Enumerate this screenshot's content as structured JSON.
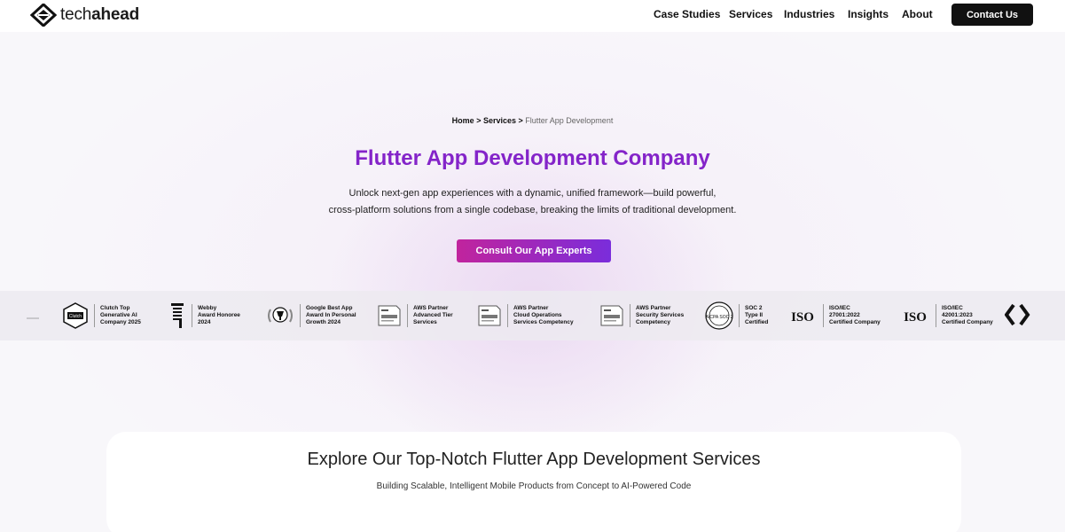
{
  "header": {
    "logo_text_light": "tech",
    "logo_text_bold": "ahead",
    "nav": [
      {
        "label": "Case Studies"
      },
      {
        "label": "Services"
      },
      {
        "label": "Industries"
      },
      {
        "label": "Insights"
      },
      {
        "label": "About"
      }
    ],
    "contact_label": "Contact Us"
  },
  "hero": {
    "breadcrumb": {
      "home": "Home",
      "sep1": " > ",
      "services": "Services",
      "sep2": " > ",
      "current": "Flutter App Development"
    },
    "title": "Flutter App Development Company",
    "subtitle_line1": "Unlock next-gen app experiences with a dynamic, unified framework—build powerful,",
    "subtitle_line2": "cross-platform solutions from a single codebase, breaking the limits of traditional development.",
    "cta_label": "Consult Our App Experts"
  },
  "awards": [
    {
      "icon": "clutch-badge-icon",
      "icon_label": "Clutch",
      "text": "Clutch Top\nGenerative AI\nCompany 2025"
    },
    {
      "icon": "webby-award-icon",
      "text": "Webby\nAward Honoree\n2024"
    },
    {
      "icon": "google-best-app-icon",
      "text": "Google Best App\nAward In Personal\nGrowth 2024"
    },
    {
      "icon": "aws-partner-icon",
      "text": "AWS Partner\nAdvanced Tier\nServices"
    },
    {
      "icon": "aws-partner-icon",
      "text": "AWS Partner\nCloud Operations\nServices Competency"
    },
    {
      "icon": "aws-partner-icon",
      "text": "AWS Partner\nSecurity Services\nCompetency"
    },
    {
      "icon": "aicpa-soc2-icon",
      "icon_label": "AICPA SOC 2",
      "text": "SOC 2\nType II\nCertified"
    },
    {
      "icon": "iso-logo-icon",
      "icon_label": "ISO",
      "text": "ISO/IEC\n27001:2022\nCertified Company"
    },
    {
      "icon": "iso-logo-icon",
      "icon_label": "ISO",
      "text": "ISO/IEC\n42001:2023\nCertified Company"
    }
  ],
  "services": {
    "title": "Explore Our Top-Notch Flutter App Development Services",
    "subtitle": "Building Scalable, Intelligent Mobile Products from Concept to AI-Powered Code"
  },
  "colors": {
    "accent_purple": "#8424c9",
    "cta_start": "#c1249d",
    "cta_end": "#7a2ddb",
    "contact_bg": "#111111"
  }
}
